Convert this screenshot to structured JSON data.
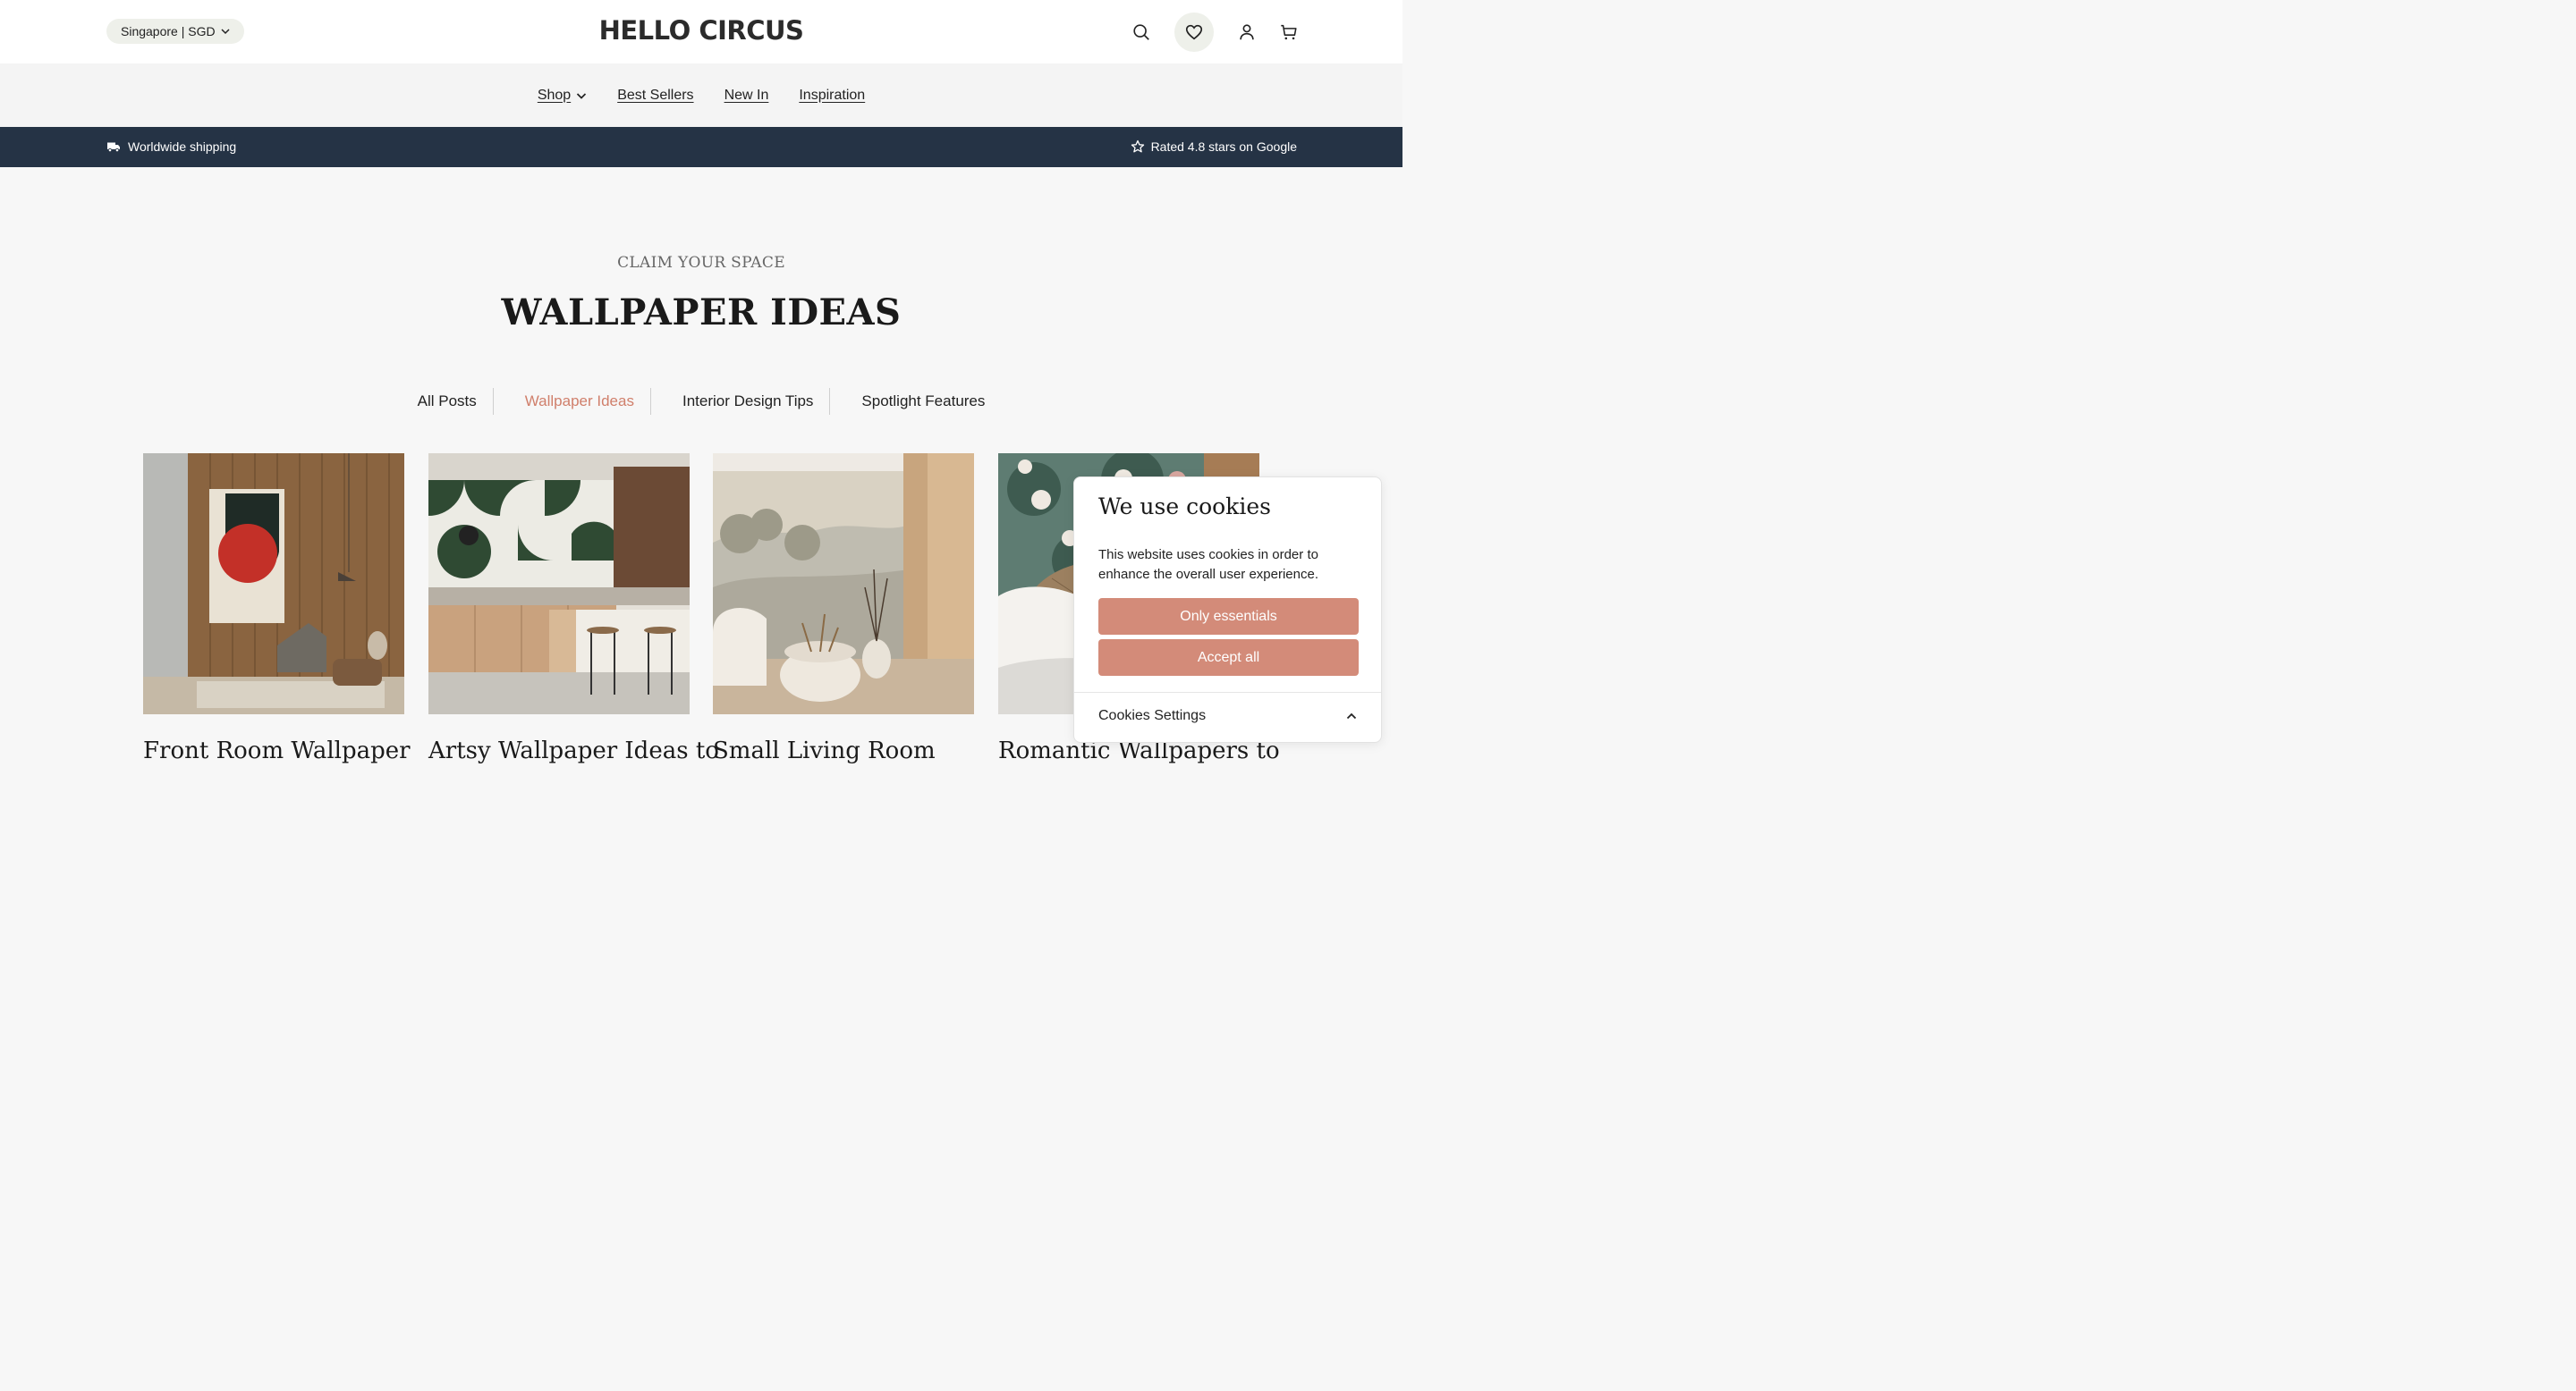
{
  "header": {
    "region": "Singapore | SGD",
    "logo": "HELLO CIRCUS",
    "icons": [
      "search-icon",
      "heart-icon",
      "account-icon",
      "cart-icon"
    ]
  },
  "nav": {
    "items": [
      {
        "label": "Shop",
        "has_dropdown": true
      },
      {
        "label": "Best Sellers"
      },
      {
        "label": "New In"
      },
      {
        "label": "Inspiration"
      }
    ]
  },
  "promo": {
    "left": "Worldwide shipping",
    "right": "Rated 4.8 stars on Google"
  },
  "hero": {
    "eyebrow": "CLAIM YOUR SPACE",
    "title": "WALLPAPER IDEAS"
  },
  "tabs": [
    {
      "label": "All Posts",
      "active": false
    },
    {
      "label": "Wallpaper Ideas",
      "active": true
    },
    {
      "label": "Interior Design Tips",
      "active": false
    },
    {
      "label": "Spotlight Features",
      "active": false
    }
  ],
  "posts": [
    {
      "title": "Front Room Wallpaper"
    },
    {
      "title": "Artsy Wallpaper Ideas to"
    },
    {
      "title": "Small Living Room"
    },
    {
      "title": "Romantic Wallpapers to"
    }
  ],
  "cookie": {
    "heading": "We use cookies",
    "body": "This website uses cookies in order to enhance the overall user experience.",
    "essentials_label": "Only essentials",
    "accept_label": "Accept all",
    "settings_label": "Cookies Settings"
  },
  "colors": {
    "accent": "#d07f6b",
    "promo_bg": "#253345",
    "button": "#d38b79"
  }
}
